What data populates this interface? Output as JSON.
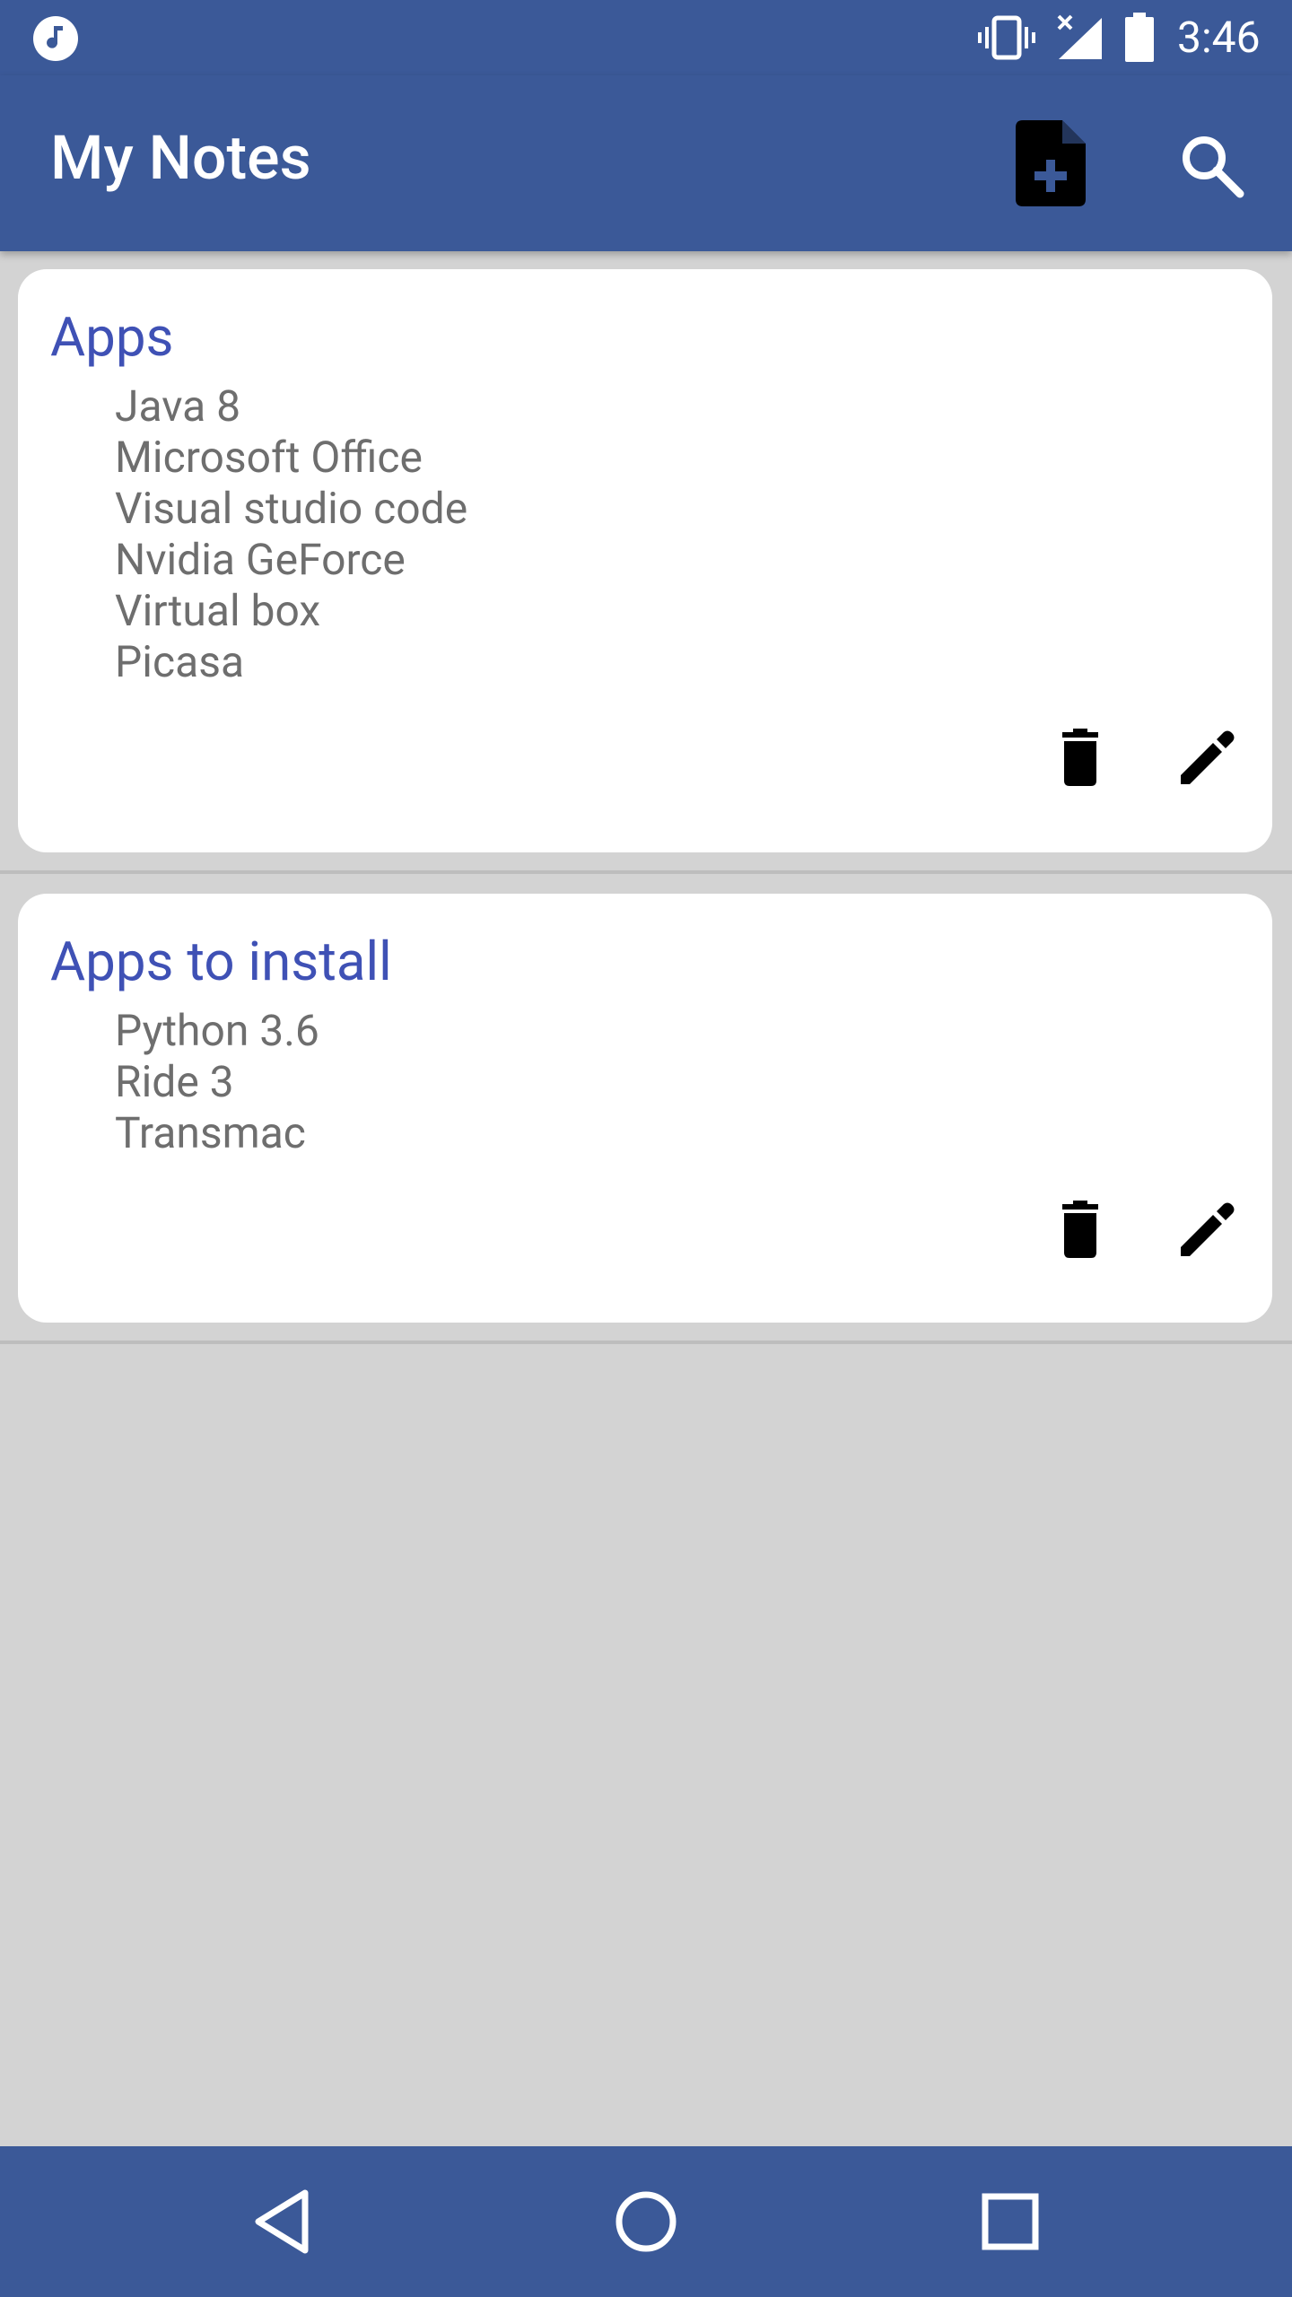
{
  "status_bar": {
    "time": "3:46",
    "icons": [
      "music-note-icon",
      "vibrate-icon",
      "signal-no-data-icon",
      "battery-icon"
    ]
  },
  "app_bar": {
    "title": "My Notes",
    "actions": [
      "note-add-icon",
      "search-icon"
    ]
  },
  "notes": [
    {
      "title": "Apps",
      "items": [
        "Java 8",
        "Microsoft Office",
        "Visual studio code",
        "Nvidia GeForce",
        "Virtual box",
        "Picasa"
      ]
    },
    {
      "title": "Apps to install",
      "items": [
        "Python 3.6",
        "Ride 3",
        "Transmac"
      ]
    }
  ],
  "nav_bar": {
    "buttons": [
      "back-icon",
      "home-icon",
      "recents-icon"
    ]
  },
  "colors": {
    "primary": "#3b5998",
    "note_title": "#3f51b5",
    "note_text": "#6e6e6e",
    "background": "#d3d3d3",
    "card": "#ffffff"
  }
}
